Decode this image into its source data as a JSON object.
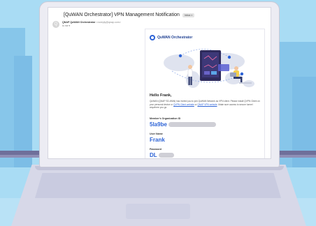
{
  "email": {
    "subject": "[QuWAN Orchestrator] VPN Management Notification",
    "inbox_badge": "Inbox ×",
    "sender_name": "QNAP QuWAN Orchestrator",
    "sender_email": "<noreply@qnap.com>",
    "to_line": "to me ▾",
    "avatar_letter": "Q"
  },
  "body": {
    "logo_text": "QuWAN Orchestrator",
    "greeting": "Hello Frank,",
    "text_before_link1": "QuWAN (QNAP SD-WAN) has invited you to join QuWAN Network as VPN client. Please install QVPN Client on your personal device or ",
    "link1": "QVPN Client website",
    "text_between": " or ",
    "link2": "QNAP VPN website",
    "text_after": ". Make sure access to secure tunnel anywhere you go.",
    "fields": [
      {
        "label": "Member's Organization ID",
        "value": "5la9be"
      },
      {
        "label": "User Name",
        "value": "Frank"
      },
      {
        "label": "Password",
        "value": "DL"
      }
    ]
  },
  "colors": {
    "accent": "#2d63d6",
    "sky": "#a9dcf4",
    "laptop": "#ececf3"
  },
  "icons": [
    "qnap-logo-icon",
    "avatar-icon"
  ]
}
